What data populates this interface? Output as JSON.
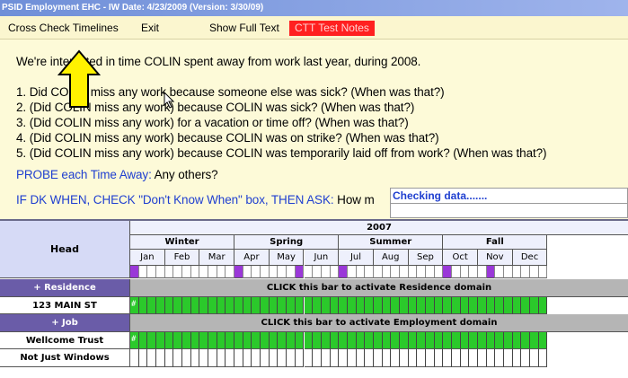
{
  "window": {
    "title": "PSID Employment EHC - IW Date: 4/23/2009 (Version: 3/30/09)"
  },
  "menu": {
    "cross_check": "Cross Check Timelines",
    "exit": "Exit",
    "show_full_text": "Show Full Text",
    "ctt_notes": "CTT Test Notes"
  },
  "question": {
    "intro": "We're interested in time COLIN spent away from work last year, during 2008.",
    "items": [
      "1. Did COLIN miss any work because someone else was sick? (When was that?)",
      "2. (Did COLIN miss any work) because COLIN was sick? (When was that?)",
      "3. (Did COLIN miss any work) for a vacation or time off? (When was that?)",
      "4. (Did COLIN miss any work) because COLIN was on strike? (When was that?)",
      "5. (Did COLIN miss any work) because COLIN was temporarily laid off from work? (When was that?)"
    ],
    "probe_label": "PROBE each Time Away:",
    "probe_text": " Any others?",
    "dk_label": "IF DK WHEN, CHECK \"Don't Know When\" box, THEN ASK:",
    "dk_text": " How m"
  },
  "checking": {
    "label": "Checking data......."
  },
  "calendar": {
    "head_label": "Head",
    "year": "2007",
    "seasons": [
      "Winter",
      "Spring",
      "Summer",
      "Fall"
    ],
    "months": [
      "Jan",
      "Feb",
      "Mar",
      "Apr",
      "May",
      "Jun",
      "Jul",
      "Aug",
      "Sep",
      "Oct",
      "Nov",
      "Dec"
    ],
    "rows": [
      {
        "label": "+ Residence",
        "type": "domain",
        "text": "CLICK this bar to activate Residence domain"
      },
      {
        "label": "123 MAIN ST",
        "type": "fill",
        "mark": "#"
      },
      {
        "label": "+ Job",
        "type": "domain",
        "text": "CLICK this bar to activate Employment domain"
      },
      {
        "label": "Wellcome Trust",
        "type": "fill",
        "mark": "#"
      },
      {
        "label": "Not Just Windows",
        "type": "empty"
      }
    ]
  },
  "colors": {
    "green": "#2bc92b",
    "purple": "#9a38d8",
    "domain_bar": "#b5b5b5",
    "header_blue": "#d6daf6",
    "header_light": "#eef0fc",
    "label_purple": "#6a5ca8"
  }
}
